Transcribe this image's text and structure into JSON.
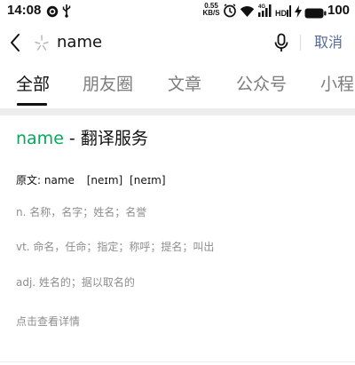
{
  "status_bar": {
    "time": "14:08",
    "net_speed_value": "0.55",
    "net_speed_unit": "KB/S",
    "battery_level": "100",
    "icons": [
      "record-icon",
      "usb-icon",
      "alarm-icon",
      "wifi-icon",
      "signal-4g-icon",
      "signal-hd-icon",
      "charging-icon",
      "battery-icon"
    ]
  },
  "search": {
    "query": "name",
    "cancel_label": "取消",
    "icons": [
      "back-icon",
      "sparkle-icon",
      "microphone-icon"
    ]
  },
  "tabs": [
    {
      "label": "全部",
      "active": true
    },
    {
      "label": "朋友圈",
      "active": false
    },
    {
      "label": "文章",
      "active": false
    },
    {
      "label": "公众号",
      "active": false
    },
    {
      "label": "小程",
      "active": false
    }
  ],
  "result": {
    "word": "name",
    "title_suffix": " - 翻译服务",
    "original_label": "原文: name",
    "phonetic_1": "[neɪm]",
    "phonetic_2": "[neɪm]",
    "definitions": [
      "n. 名称，名字；姓名；名誉",
      "vt. 命名，任命；指定；称呼；提名；叫出",
      "adj. 姓名的；据以取名的"
    ],
    "details_label": "点击查看详情"
  },
  "colors": {
    "accent_green": "#07a85c",
    "link_blue": "#576b95",
    "muted_text": "#8e8e8e",
    "separator": "#ededed"
  }
}
